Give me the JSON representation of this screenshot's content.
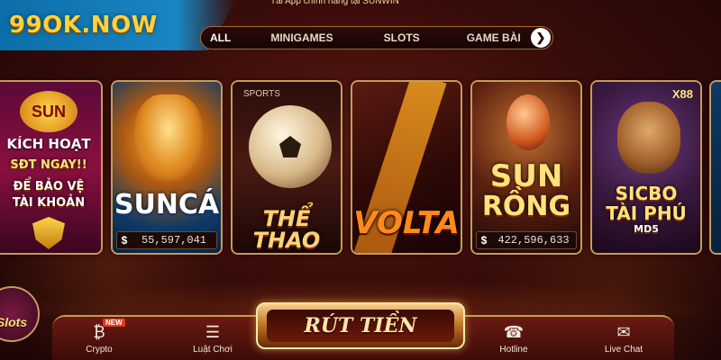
{
  "brand": {
    "logo_text": "99OK.NOW"
  },
  "notice": {
    "text": "Tải App chính hãng tại SUNWIN"
  },
  "tabs": [
    {
      "label": "ALL",
      "active": true
    },
    {
      "label": "MINIGAMES",
      "active": false
    },
    {
      "label": "SLOTS",
      "active": false
    },
    {
      "label": "GAME BÀI",
      "active": false
    }
  ],
  "tab_next_icon": "chevron-right-icon",
  "cards": [
    {
      "id": "promo",
      "logo": "SUN",
      "lines": [
        "KÍCH HOẠT",
        "SĐT NGAY!!",
        "ĐỂ BẢO VỆ",
        "TÀI KHOẢN"
      ],
      "icon": "shield-check-icon"
    },
    {
      "id": "sun-ca",
      "title": "SUNCÁ",
      "jackpot_symbol": "$",
      "jackpot": "55,597,041"
    },
    {
      "id": "the-thao",
      "tag": "SPORTS",
      "title": "THỂ THAO"
    },
    {
      "id": "volta",
      "title": "VOLTA"
    },
    {
      "id": "sun-rong",
      "title_1": "SUN",
      "title_2": "RỒNG",
      "jackpot_symbol": "$",
      "jackpot": "422,596,633"
    },
    {
      "id": "sicbo",
      "badge": "X88",
      "title_1": "SICBO",
      "title_2": "TÀI PHÚ",
      "title_3": "MD5"
    }
  ],
  "slots_badge": {
    "label": "Slots"
  },
  "bottom_nav": {
    "crypto": {
      "label": "Crypto",
      "badge": "NEW",
      "icon": "bitcoin-icon"
    },
    "rules": {
      "label": "Luật Chơi",
      "icon": "book-icon"
    },
    "withdraw": {
      "label": "RÚT TIỀN"
    },
    "hotline": {
      "label": "Hotline",
      "icon": "phone-icon"
    },
    "chat": {
      "label": "Live Chat",
      "icon": "chat-icon"
    }
  },
  "colors": {
    "accent_gold": "#ffe27a",
    "brand_blue": "#1a86c4",
    "background": "#3a0d0a"
  }
}
